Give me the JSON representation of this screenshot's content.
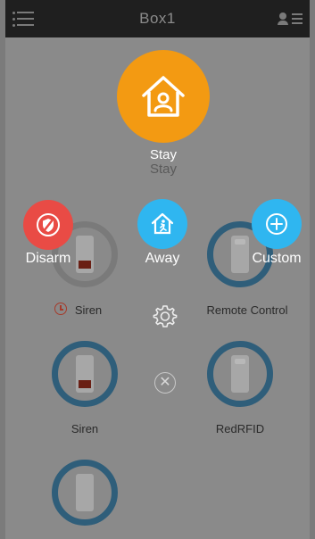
{
  "header": {
    "title": "Box1"
  },
  "actions": {
    "stay": {
      "label": "Stay",
      "sublabel": "Stay"
    },
    "disarm": {
      "label": "Disarm"
    },
    "away": {
      "label": "Away"
    },
    "custom": {
      "label": "Custom"
    }
  },
  "devices": [
    {
      "label": "Siren"
    },
    {
      "label": "Remote Control"
    },
    {
      "label": "Siren"
    },
    {
      "label": "RedRFID"
    },
    {
      "label": ""
    }
  ],
  "icons": {
    "menu": "list-menu-icon",
    "account": "user-list-icon",
    "stay": "house-person-icon",
    "disarm": "shield-slash-icon",
    "away": "house-running-icon",
    "custom": "plus-circle-icon",
    "timer": "clock-icon",
    "settings": "gear-icon",
    "close": "close-icon"
  },
  "colors": {
    "stay": "#f39a12",
    "disarm": "#e94b45",
    "away": "#2fb6f0",
    "custom": "#2fb6f0",
    "device_ring": "#2f5e7a"
  }
}
